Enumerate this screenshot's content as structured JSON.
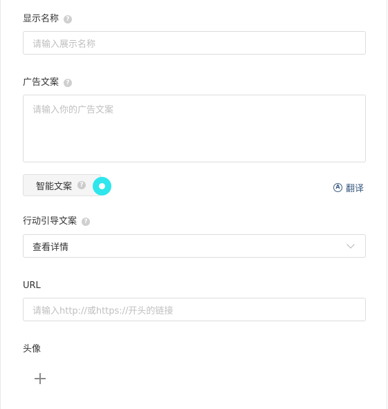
{
  "display_name": {
    "label": "显示名称",
    "help": "?",
    "placeholder": "请输入展示名称"
  },
  "ad_copy": {
    "label": "广告文案",
    "help": "?",
    "placeholder": "请输入你的广告文案"
  },
  "smart_copy": {
    "label": "智能文案",
    "help": "?"
  },
  "translate": {
    "icon": "translate-icon",
    "label": "翻译"
  },
  "cta": {
    "label": "行动引导文案",
    "help": "?",
    "selected": "查看详情"
  },
  "url": {
    "label": "URL",
    "placeholder": "请输入http://或https://开头的链接"
  },
  "avatar": {
    "label": "头像",
    "icon": "plus-icon"
  },
  "colors": {
    "accent_cursor": "#2ee6ec",
    "link": "#3a5a80",
    "border": "#dcdcdc"
  }
}
